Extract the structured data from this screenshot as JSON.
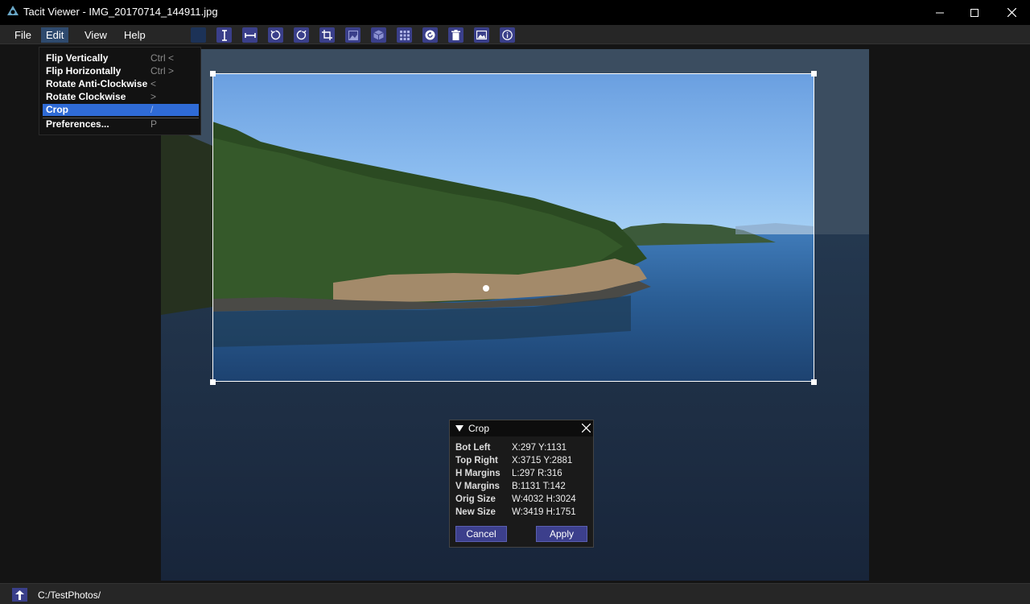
{
  "window": {
    "title": "Tacit Viewer - IMG_20170714_144911.jpg",
    "minimize_icon": "minimize-icon",
    "maximize_icon": "maximize-icon",
    "close_icon": "close-icon"
  },
  "menubar": {
    "items": [
      {
        "label": "File"
      },
      {
        "label": "Edit",
        "active": true
      },
      {
        "label": "View"
      },
      {
        "label": "Help"
      }
    ]
  },
  "toolbar": {
    "buttons": [
      "color-swatch-icon",
      "flip-vertical-icon",
      "flip-horizontal-icon",
      "rotate-anticlockwise-icon",
      "rotate-clockwise-icon",
      "crop-icon",
      "image-icon",
      "cube-icon",
      "grid-icon",
      "refresh-icon",
      "trash-icon",
      "photo-icon",
      "info-icon"
    ]
  },
  "edit_menu": {
    "items": [
      {
        "label": "Flip Vertically",
        "shortcut": "Ctrl <"
      },
      {
        "label": "Flip Horizontally",
        "shortcut": "Ctrl >"
      },
      {
        "label": "Rotate Anti-Clockwise",
        "shortcut": "<"
      },
      {
        "label": "Rotate Clockwise",
        "shortcut": ">"
      },
      {
        "label": "Crop",
        "shortcut": "/",
        "selected": true
      },
      {
        "label": "Preferences...",
        "shortcut": "P"
      }
    ]
  },
  "crop_dialog": {
    "title": "Crop",
    "rows": [
      {
        "label": "Bot Left",
        "value": "X:297 Y:1131"
      },
      {
        "label": "Top Right",
        "value": "X:3715 Y:2881"
      },
      {
        "label": "H Margins",
        "value": "L:297 R:316"
      },
      {
        "label": "V Margins",
        "value": "B:1131 T:142"
      },
      {
        "label": "Orig Size",
        "value": "W:4032 H:3024"
      },
      {
        "label": "New Size",
        "value": "W:3419 H:1751"
      }
    ],
    "cancel_label": "Cancel",
    "apply_label": "Apply"
  },
  "statusbar": {
    "path": "C:/TestPhotos/"
  },
  "colors": {
    "accent": "#2f6bd6",
    "button": "#3c3f8c",
    "menu_active": "#2e4a6e"
  }
}
